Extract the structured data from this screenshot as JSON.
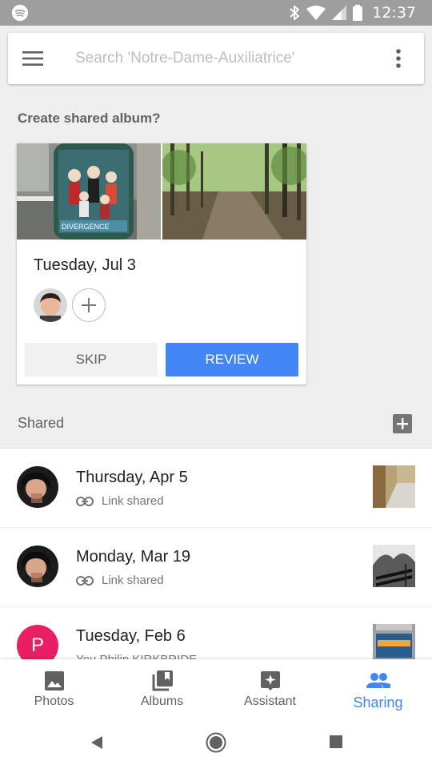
{
  "status_bar": {
    "time": "12:37",
    "icons": [
      "spotify-icon",
      "bluetooth-icon",
      "wifi-icon",
      "signal-icon",
      "battery-icon"
    ]
  },
  "search": {
    "placeholder": "Search 'Notre-Dame-Auxiliatrice'"
  },
  "suggestion": {
    "section_title": "Create shared album?",
    "date": "Tuesday, Jul 3",
    "skip_label": "SKIP",
    "review_label": "REVIEW"
  },
  "shared": {
    "section_title": "Shared",
    "items": [
      {
        "title": "Thursday, Apr 5",
        "subtitle": "Link shared"
      },
      {
        "title": "Monday, Mar 19",
        "subtitle": "Link shared"
      },
      {
        "title": "Tuesday, Feb 6",
        "subtitle": "You Philip KIRKBRIDE",
        "avatar_letter": "P"
      }
    ]
  },
  "bottom_nav": {
    "items": [
      {
        "label": "Photos",
        "icon": "photo-icon"
      },
      {
        "label": "Albums",
        "icon": "albums-icon"
      },
      {
        "label": "Assistant",
        "icon": "assistant-icon"
      },
      {
        "label": "Sharing",
        "icon": "people-icon",
        "active": true
      }
    ]
  },
  "colors": {
    "accent": "#4285f4",
    "status_bar": "#9e9e9e",
    "avatar_pink": "#e91e63"
  }
}
